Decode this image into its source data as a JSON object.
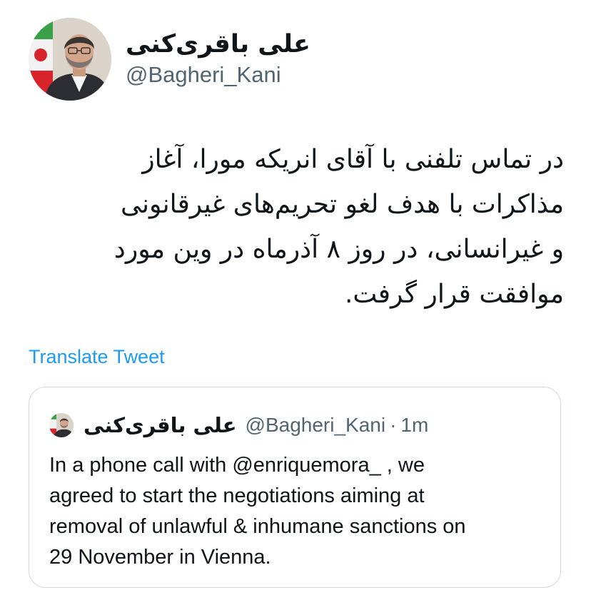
{
  "author": {
    "display_name": "علی باقری‌کنی",
    "handle": "@Bagheri_Kani",
    "avatar_icon": "profile-photo"
  },
  "tweet": {
    "lines": [
      "در تماس تلفنی با آقای انریکه مورا، آغاز",
      "مذاکرات با هدف لغو تحریم‌های غیرقانونی",
      "و غیرانسانی، در روز ۸ آذرماه در وین مورد",
      "موافقت قرار گرفت."
    ],
    "translate_label": "Translate Tweet"
  },
  "quoted_tweet": {
    "display_name": "علی باقری‌کنی",
    "handle": "@Bagheri_Kani",
    "separator": "·",
    "time": "1m",
    "lines": [
      "In a phone call with @enriquemora_ , we",
      "agreed to start the negotiations aiming at",
      "removal of unlawful & inhumane sanctions on",
      "29 November in Vienna."
    ]
  },
  "colors": {
    "text": "#0f1419",
    "secondary": "#536471",
    "link": "#1d9bf0",
    "border": "#cfd9de"
  }
}
